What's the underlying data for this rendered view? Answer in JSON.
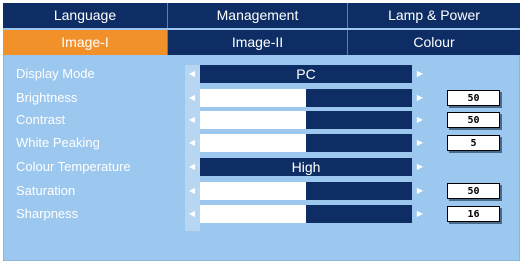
{
  "menu": {
    "tabs_top": [
      {
        "label": "Language"
      },
      {
        "label": "Management"
      },
      {
        "label": "Lamp & Power"
      }
    ],
    "tabs_bottom": [
      {
        "label": "Image-I",
        "active": true
      },
      {
        "label": "Image-II",
        "active": false
      },
      {
        "label": "Colour",
        "active": false
      }
    ]
  },
  "settings": [
    {
      "label": "Display Mode",
      "kind": "select",
      "value": "PC"
    },
    {
      "label": "Brightness",
      "kind": "slider",
      "level": 0.5,
      "value": "50"
    },
    {
      "label": "Contrast",
      "kind": "slider",
      "level": 0.5,
      "value": "50"
    },
    {
      "label": "White Peaking",
      "kind": "slider",
      "level": 0.5,
      "value": "5"
    },
    {
      "label": "Colour Temperature",
      "kind": "select",
      "value": "High"
    },
    {
      "label": "Saturation",
      "kind": "slider",
      "level": 0.5,
      "value": "50"
    },
    {
      "label": "Sharpness",
      "kind": "slider",
      "level": 0.5,
      "value": "16"
    }
  ],
  "colors": {
    "panel": "#9cc7ee",
    "tab": "#0d2d64",
    "tab_active": "#f2902a",
    "bar": "#0d2d64",
    "fill": "#ffffff"
  },
  "icons": {
    "left": "triangle-left-icon",
    "right": "triangle-right-icon"
  }
}
